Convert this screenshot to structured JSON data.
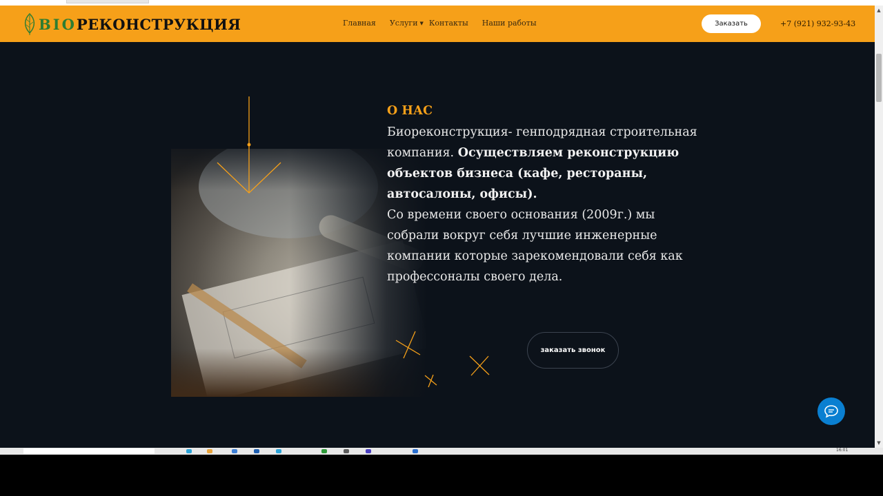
{
  "header": {
    "logo_prefix": "BIO",
    "logo_text": "РЕКОНСТРУКЦИЯ",
    "nav": [
      {
        "label": "Главная"
      },
      {
        "label": "Услуги",
        "has_dropdown": true
      },
      {
        "label": "Контакты"
      },
      {
        "label": "Наши работы"
      }
    ],
    "order_label": "Заказать",
    "phone": "+7 (921) 932-93-43"
  },
  "about": {
    "title": "О НАС",
    "line1_plain": "Биореконструкция- генподрядная строительная компания.",
    "line1_bold": "Осуществляем реконструкцию объектов бизнеса (кафе, рестораны, автосалоны, офисы).",
    "paragraph2": "Со времени своего основания (2009г.) мы собрали вокруг себя лучшие инженерные компании которые зарекомендовали себя как профессоналы своего дела."
  },
  "call_button_label": "заказать звонок",
  "taskbar": {
    "clock": "16:01"
  },
  "colors": {
    "accent": "#f6a019",
    "background": "#0c121a",
    "chat": "#0a7fd1"
  },
  "icons": [
    "leaf-icon",
    "chevron-down-icon",
    "chat-icon",
    "arrow-down-icon"
  ]
}
